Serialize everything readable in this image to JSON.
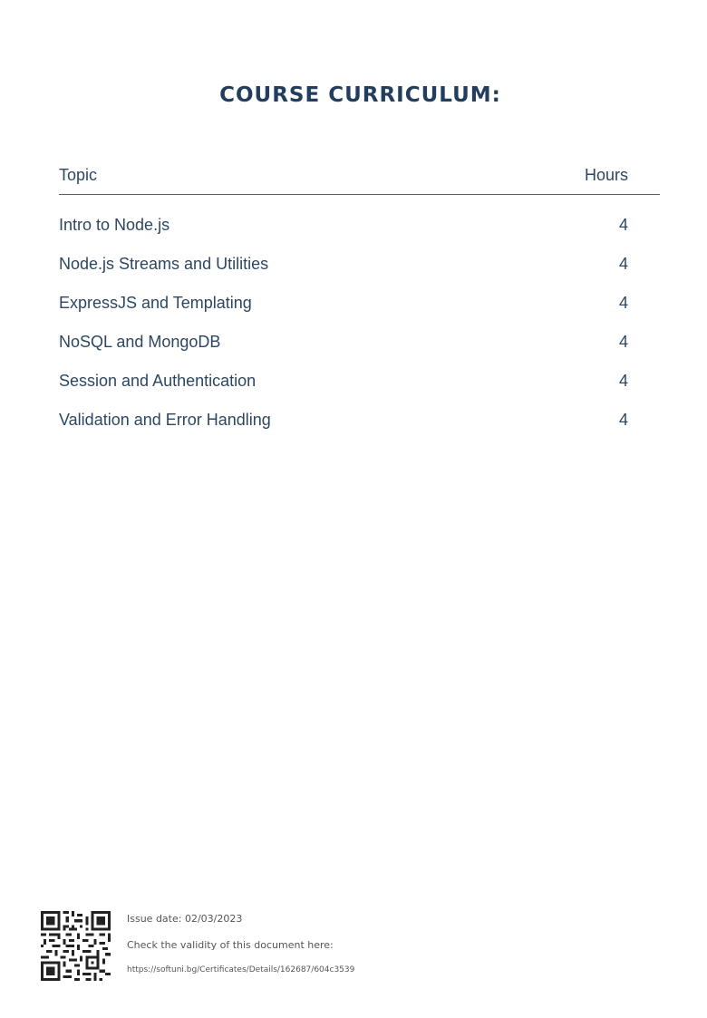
{
  "title": "COURSE CURRICULUM:",
  "table": {
    "headers": {
      "topic": "Topic",
      "hours": "Hours"
    },
    "rows": [
      {
        "topic": "Intro to Node.js",
        "hours": "4"
      },
      {
        "topic": "Node.js Streams and Utilities",
        "hours": "4"
      },
      {
        "topic": "ExpressJS and Templating",
        "hours": "4"
      },
      {
        "topic": "NoSQL and MongoDB",
        "hours": "4"
      },
      {
        "topic": "Session and Authentication",
        "hours": "4"
      },
      {
        "topic": "Validation and Error Handling",
        "hours": "4"
      }
    ]
  },
  "footer": {
    "issue_date": "Issue date: 02/03/2023",
    "check_text": "Check the validity of this document here:",
    "url": "https://softuni.bg/Certificates/Details/162687/604c3539",
    "qr_icon": "qr-code-icon"
  },
  "colors": {
    "title": "#233e5c",
    "text": "#2d4763",
    "rule": "#55606c",
    "footer_text": "#555555"
  }
}
